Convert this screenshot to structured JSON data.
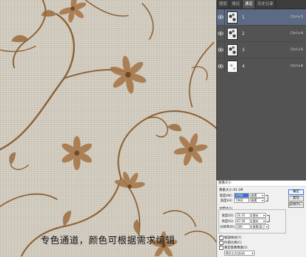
{
  "caption": "专色通道，颜色可根据需求编辑",
  "colors": {
    "canvas_bg": "#cfc9bc",
    "flower": "#9a6b3d",
    "vine": "#8c6236",
    "panel_bg": "#535353",
    "selected_row": "#5c6a84"
  },
  "panel": {
    "tabs": [
      "图层",
      "路径",
      "通道",
      "历史记录"
    ],
    "active_tab": "通道",
    "channels": [
      {
        "name": "1",
        "shortcut": "Ctrl+3",
        "selected": true
      },
      {
        "name": "2",
        "shortcut": "Ctrl+4",
        "selected": false
      },
      {
        "name": "3",
        "shortcut": "Ctrl+5",
        "selected": false
      },
      {
        "name": "4",
        "shortcut": "Ctrl+6",
        "selected": false
      }
    ]
  },
  "dialog": {
    "title": "图像大小",
    "pixel_size_line": "像素大小:45.1M",
    "px_width_label": "宽度(W):",
    "px_width_value": "3760",
    "px_width_unit": "像素",
    "px_height_label": "高度(H):",
    "px_height_value": "7960",
    "px_height_unit": "像素",
    "doc_size_title": "文档大小:",
    "doc_width_label": "宽度(D):",
    "doc_width_value": "31.01",
    "doc_width_unit": "厘米",
    "doc_height_label": "高度(G):",
    "doc_height_value": "67.40",
    "doc_height_unit": "厘米",
    "resolution_label": "分辨率(R):",
    "resolution_value": "300",
    "resolution_unit": "像素/英寸",
    "opt_scale_styles": "缩放样式(Y)",
    "opt_constrain": "约束比例(C)",
    "opt_resample": "重定图像像素(I):",
    "resample_method": "两次立方(自动)",
    "btn_ok": "确定",
    "btn_reset": "复位",
    "btn_auto": "自动(A)..."
  }
}
